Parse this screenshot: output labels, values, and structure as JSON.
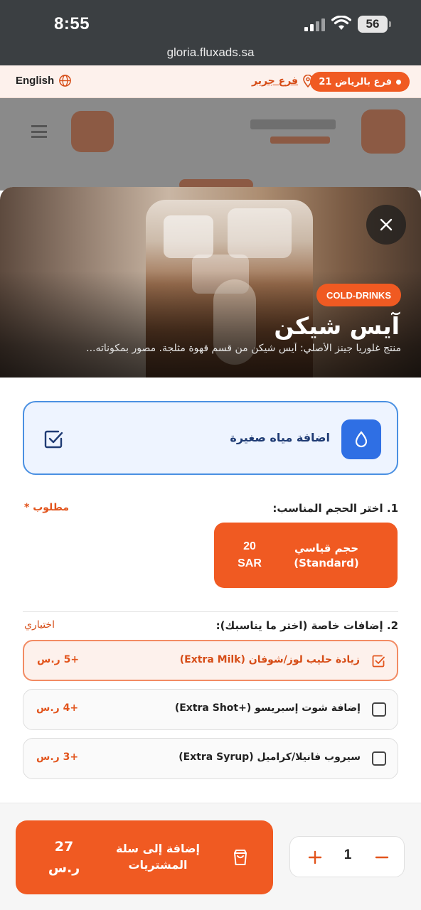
{
  "status_bar": {
    "time": "8:55",
    "battery": "56"
  },
  "browser": {
    "url": "gloria.fluxads.sa"
  },
  "top_bar": {
    "language": "English",
    "branch_link": "فرع جرير",
    "branch_count_badge": "21 فرع بالرياض"
  },
  "product": {
    "category": "COLD-DRINKS",
    "title": "آيس شيكن",
    "description": "منتج غلوريا جينز الأصلي: آيس شيكن من قسم قهوة مثلجة. مصور بمكوناته..."
  },
  "water_option": {
    "label": "اضافة مياه صغيرة",
    "checked": true
  },
  "size_section": {
    "title": "1. اختر الحجم المناسب:",
    "required_tag": "مطلوب *",
    "options": [
      {
        "name_line1": "حجم قياسي",
        "name_line2": "(Standard)",
        "price_value": "20",
        "price_currency": "SAR",
        "selected": true
      }
    ]
  },
  "extras_section": {
    "title": "2. إضافات خاصة (اختر ما يناسبك):",
    "optional_tag": "اختياري",
    "items": [
      {
        "label": "زيادة حليب لوز/شوفان (Extra Milk)",
        "price": "+5 ر.س",
        "checked": true
      },
      {
        "label": "إضافة شوت إسبريسو (+Extra Shot)",
        "price": "+4 ر.س",
        "checked": false
      },
      {
        "label": "سيروب فانيلا/كراميل (Extra Syrup)",
        "price": "+3 ر.س",
        "checked": false
      }
    ]
  },
  "cart": {
    "add_label_line1": "إضافة إلى سلة",
    "add_label_line2": "المشتريات",
    "total_value": "27",
    "total_currency": "ر.س",
    "quantity": "1"
  },
  "colors": {
    "accent": "#f05a22",
    "water_blue": "#2f6fe4",
    "water_border": "#4a90e2"
  },
  "icons": [
    "globe-icon",
    "location-pin-icon",
    "close-icon",
    "water-drop-icon",
    "checkbox-checked-icon",
    "checkbox-icon",
    "shopping-bag-icon",
    "plus-icon",
    "minus-icon"
  ]
}
